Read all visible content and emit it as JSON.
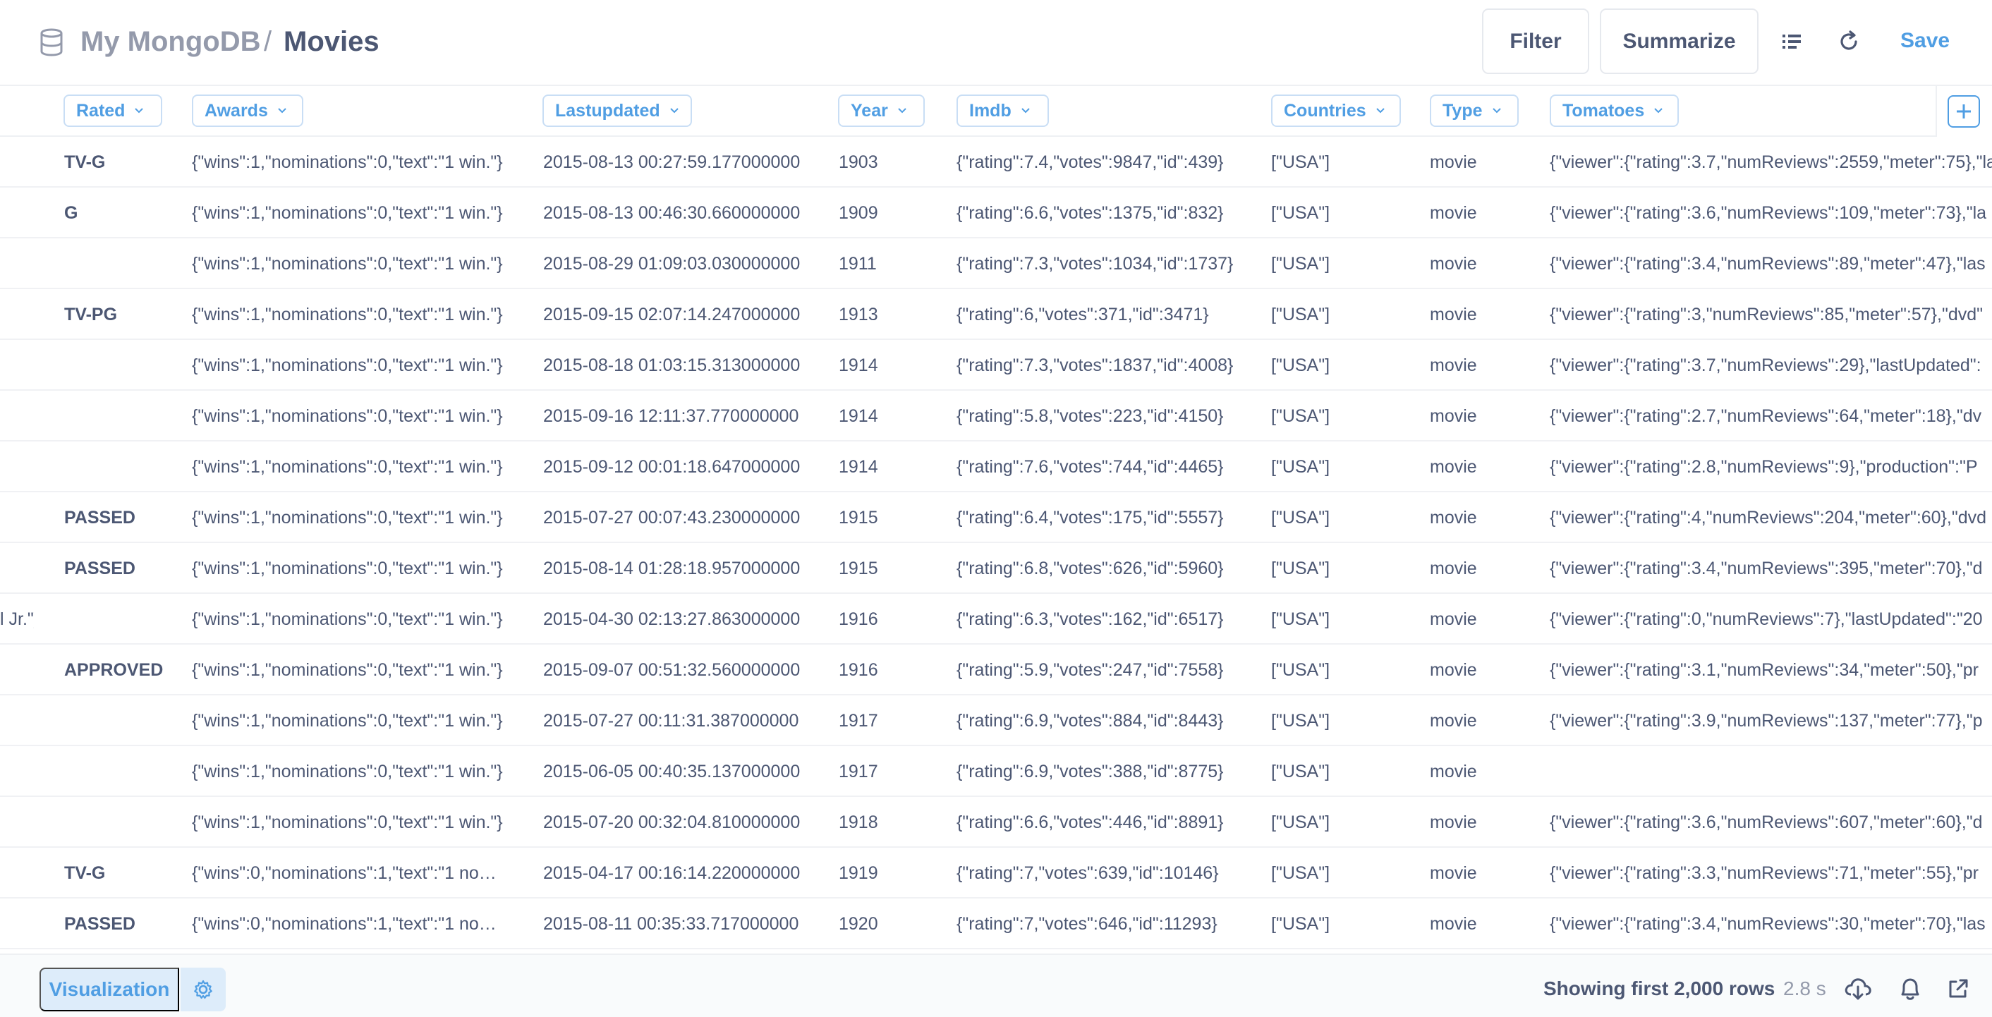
{
  "header": {
    "database": "My MongoDB",
    "separator": "/",
    "title": "Movies",
    "filter_label": "Filter",
    "summarize_label": "Summarize",
    "save_label": "Save"
  },
  "columns": [
    {
      "key": "rated",
      "label": "Rated"
    },
    {
      "key": "awards",
      "label": "Awards"
    },
    {
      "key": "lastupdated",
      "label": "Lastupdated"
    },
    {
      "key": "year",
      "label": "Year"
    },
    {
      "key": "imdb",
      "label": "Imdb"
    },
    {
      "key": "countries",
      "label": "Countries"
    },
    {
      "key": "type",
      "label": "Type"
    },
    {
      "key": "tomatoes",
      "label": "Tomatoes"
    }
  ],
  "rows": [
    {
      "prev": "",
      "rated": "TV-G",
      "awards": "{\"wins\":1,\"nominations\":0,\"text\":\"1 win.\"}",
      "lastupdated": "2015-08-13 00:27:59.177000000",
      "year": "1903",
      "imdb": "{\"rating\":7.4,\"votes\":9847,\"id\":439}",
      "countries": "[\"USA\"]",
      "type": "movie",
      "tomatoes": "{\"viewer\":{\"rating\":3.7,\"numReviews\":2559,\"meter\":75},\"la"
    },
    {
      "prev": "",
      "rated": "G",
      "awards": "{\"wins\":1,\"nominations\":0,\"text\":\"1 win.\"}",
      "lastupdated": "2015-08-13 00:46:30.660000000",
      "year": "1909",
      "imdb": "{\"rating\":6.6,\"votes\":1375,\"id\":832}",
      "countries": "[\"USA\"]",
      "type": "movie",
      "tomatoes": "{\"viewer\":{\"rating\":3.6,\"numReviews\":109,\"meter\":73},\"la"
    },
    {
      "prev": "",
      "rated": "",
      "awards": "{\"wins\":1,\"nominations\":0,\"text\":\"1 win.\"}",
      "lastupdated": "2015-08-29 01:09:03.030000000",
      "year": "1911",
      "imdb": "{\"rating\":7.3,\"votes\":1034,\"id\":1737}",
      "countries": "[\"USA\"]",
      "type": "movie",
      "tomatoes": "{\"viewer\":{\"rating\":3.4,\"numReviews\":89,\"meter\":47},\"las"
    },
    {
      "prev": "",
      "rated": "TV-PG",
      "awards": "{\"wins\":1,\"nominations\":0,\"text\":\"1 win.\"}",
      "lastupdated": "2015-09-15 02:07:14.247000000",
      "year": "1913",
      "imdb": "{\"rating\":6,\"votes\":371,\"id\":3471}",
      "countries": "[\"USA\"]",
      "type": "movie",
      "tomatoes": "{\"viewer\":{\"rating\":3,\"numReviews\":85,\"meter\":57},\"dvd\""
    },
    {
      "prev": "",
      "rated": "",
      "awards": "{\"wins\":1,\"nominations\":0,\"text\":\"1 win.\"}",
      "lastupdated": "2015-08-18 01:03:15.313000000",
      "year": "1914",
      "imdb": "{\"rating\":7.3,\"votes\":1837,\"id\":4008}",
      "countries": "[\"USA\"]",
      "type": "movie",
      "tomatoes": "{\"viewer\":{\"rating\":3.7,\"numReviews\":29},\"lastUpdated\":"
    },
    {
      "prev": "",
      "rated": "",
      "awards": "{\"wins\":1,\"nominations\":0,\"text\":\"1 win.\"}",
      "lastupdated": "2015-09-16 12:11:37.770000000",
      "year": "1914",
      "imdb": "{\"rating\":5.8,\"votes\":223,\"id\":4150}",
      "countries": "[\"USA\"]",
      "type": "movie",
      "tomatoes": "{\"viewer\":{\"rating\":2.7,\"numReviews\":64,\"meter\":18},\"dv"
    },
    {
      "prev": "",
      "rated": "",
      "awards": "{\"wins\":1,\"nominations\":0,\"text\":\"1 win.\"}",
      "lastupdated": "2015-09-12 00:01:18.647000000",
      "year": "1914",
      "imdb": "{\"rating\":7.6,\"votes\":744,\"id\":4465}",
      "countries": "[\"USA\"]",
      "type": "movie",
      "tomatoes": "{\"viewer\":{\"rating\":2.8,\"numReviews\":9},\"production\":\"P"
    },
    {
      "prev": "",
      "rated": "PASSED",
      "awards": "{\"wins\":1,\"nominations\":0,\"text\":\"1 win.\"}",
      "lastupdated": "2015-07-27 00:07:43.230000000",
      "year": "1915",
      "imdb": "{\"rating\":6.4,\"votes\":175,\"id\":5557}",
      "countries": "[\"USA\"]",
      "type": "movie",
      "tomatoes": "{\"viewer\":{\"rating\":4,\"numReviews\":204,\"meter\":60},\"dvd"
    },
    {
      "prev": "",
      "rated": "PASSED",
      "awards": "{\"wins\":1,\"nominations\":0,\"text\":\"1 win.\"}",
      "lastupdated": "2015-08-14 01:28:18.957000000",
      "year": "1915",
      "imdb": "{\"rating\":6.8,\"votes\":626,\"id\":5960}",
      "countries": "[\"USA\"]",
      "type": "movie",
      "tomatoes": "{\"viewer\":{\"rating\":3.4,\"numReviews\":395,\"meter\":70},\"d"
    },
    {
      "prev": "l Jr.\"]",
      "rated": "",
      "awards": "{\"wins\":1,\"nominations\":0,\"text\":\"1 win.\"}",
      "lastupdated": "2015-04-30 02:13:27.863000000",
      "year": "1916",
      "imdb": "{\"rating\":6.3,\"votes\":162,\"id\":6517}",
      "countries": "[\"USA\"]",
      "type": "movie",
      "tomatoes": "{\"viewer\":{\"rating\":0,\"numReviews\":7},\"lastUpdated\":\"20"
    },
    {
      "prev": "",
      "rated": "APPROVED",
      "awards": "{\"wins\":1,\"nominations\":0,\"text\":\"1 win.\"}",
      "lastupdated": "2015-09-07 00:51:32.560000000",
      "year": "1916",
      "imdb": "{\"rating\":5.9,\"votes\":247,\"id\":7558}",
      "countries": "[\"USA\"]",
      "type": "movie",
      "tomatoes": "{\"viewer\":{\"rating\":3.1,\"numReviews\":34,\"meter\":50},\"pr"
    },
    {
      "prev": "",
      "rated": "",
      "awards": "{\"wins\":1,\"nominations\":0,\"text\":\"1 win.\"}",
      "lastupdated": "2015-07-27 00:11:31.387000000",
      "year": "1917",
      "imdb": "{\"rating\":6.9,\"votes\":884,\"id\":8443}",
      "countries": "[\"USA\"]",
      "type": "movie",
      "tomatoes": "{\"viewer\":{\"rating\":3.9,\"numReviews\":137,\"meter\":77},\"p"
    },
    {
      "prev": "",
      "rated": "",
      "awards": "{\"wins\":1,\"nominations\":0,\"text\":\"1 win.\"}",
      "lastupdated": "2015-06-05 00:40:35.137000000",
      "year": "1917",
      "imdb": "{\"rating\":6.9,\"votes\":388,\"id\":8775}",
      "countries": "[\"USA\"]",
      "type": "movie",
      "tomatoes": ""
    },
    {
      "prev": "",
      "rated": "",
      "awards": "{\"wins\":1,\"nominations\":0,\"text\":\"1 win.\"}",
      "lastupdated": "2015-07-20 00:32:04.810000000",
      "year": "1918",
      "imdb": "{\"rating\":6.6,\"votes\":446,\"id\":8891}",
      "countries": "[\"USA\"]",
      "type": "movie",
      "tomatoes": "{\"viewer\":{\"rating\":3.6,\"numReviews\":607,\"meter\":60},\"d"
    },
    {
      "prev": "",
      "rated": "TV-G",
      "awards": "{\"wins\":0,\"nominations\":1,\"text\":\"1 no…",
      "lastupdated": "2015-04-17 00:16:14.220000000",
      "year": "1919",
      "imdb": "{\"rating\":7,\"votes\":639,\"id\":10146}",
      "countries": "[\"USA\"]",
      "type": "movie",
      "tomatoes": "{\"viewer\":{\"rating\":3.3,\"numReviews\":71,\"meter\":55},\"pr"
    },
    {
      "prev": "",
      "rated": "PASSED",
      "awards": "{\"wins\":0,\"nominations\":1,\"text\":\"1 no…",
      "lastupdated": "2015-08-11 00:35:33.717000000",
      "year": "1920",
      "imdb": "{\"rating\":7,\"votes\":646,\"id\":11293}",
      "countries": "[\"USA\"]",
      "type": "movie",
      "tomatoes": "{\"viewer\":{\"rating\":3.4,\"numReviews\":30,\"meter\":70},\"las"
    }
  ],
  "footer": {
    "visualization_label": "Visualization",
    "row_count": "Showing first 2,000 rows",
    "timing": "2.8 s"
  },
  "colors": {
    "accent": "#509ee3",
    "text": "#4c5773",
    "muted": "#949aab"
  },
  "icons": [
    "database-icon",
    "list-icon",
    "refresh-icon",
    "chevron-down-icon",
    "add-icon",
    "gear-icon",
    "download-icon",
    "bell-icon",
    "expand-icon"
  ]
}
